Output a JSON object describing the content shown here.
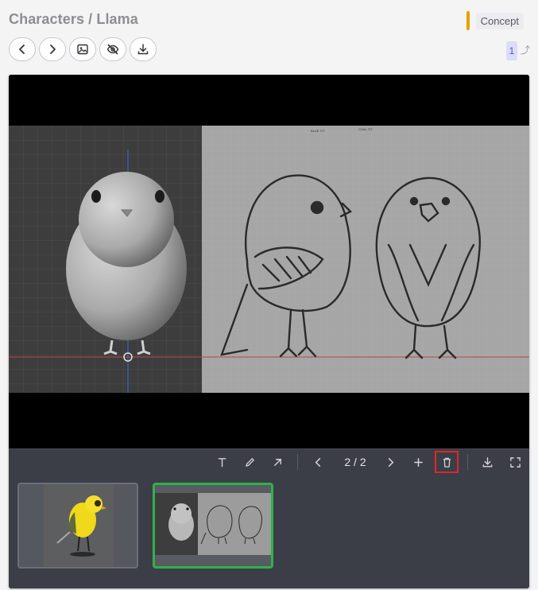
{
  "header": {
    "breadcrumb": "Characters / Llama",
    "status_label": "Concept",
    "status_color": "#e6a100",
    "version": "1",
    "version_icon": "external-arrow-icon"
  },
  "toolbar": {
    "buttons": [
      {
        "name": "previous-button",
        "icon": "chevron-left-icon"
      },
      {
        "name": "next-button",
        "icon": "chevron-right-icon"
      },
      {
        "name": "image-button",
        "icon": "image-icon"
      },
      {
        "name": "hide-button",
        "icon": "eye-off-icon"
      },
      {
        "name": "download-button",
        "icon": "download-icon"
      }
    ]
  },
  "viewer": {
    "sketch_labels": [
      "BLUE TIT",
      "COAL TIT"
    ],
    "annotation_tools": [
      "text-icon",
      "pencil-icon",
      "arrow-icon"
    ],
    "page_indicator": "2 / 2",
    "page_tools": [
      "chevron-left-icon",
      "chevron-right-icon",
      "plus-icon",
      "trash-icon"
    ],
    "view_tools": [
      "download-icon",
      "fullscreen-icon"
    ],
    "selected_tool_highlight": "#e0262c"
  },
  "thumbnails": [
    {
      "name": "thumbnail-1",
      "selected": false
    },
    {
      "name": "thumbnail-2",
      "selected": true,
      "selected_color": "#2eb24b"
    }
  ]
}
